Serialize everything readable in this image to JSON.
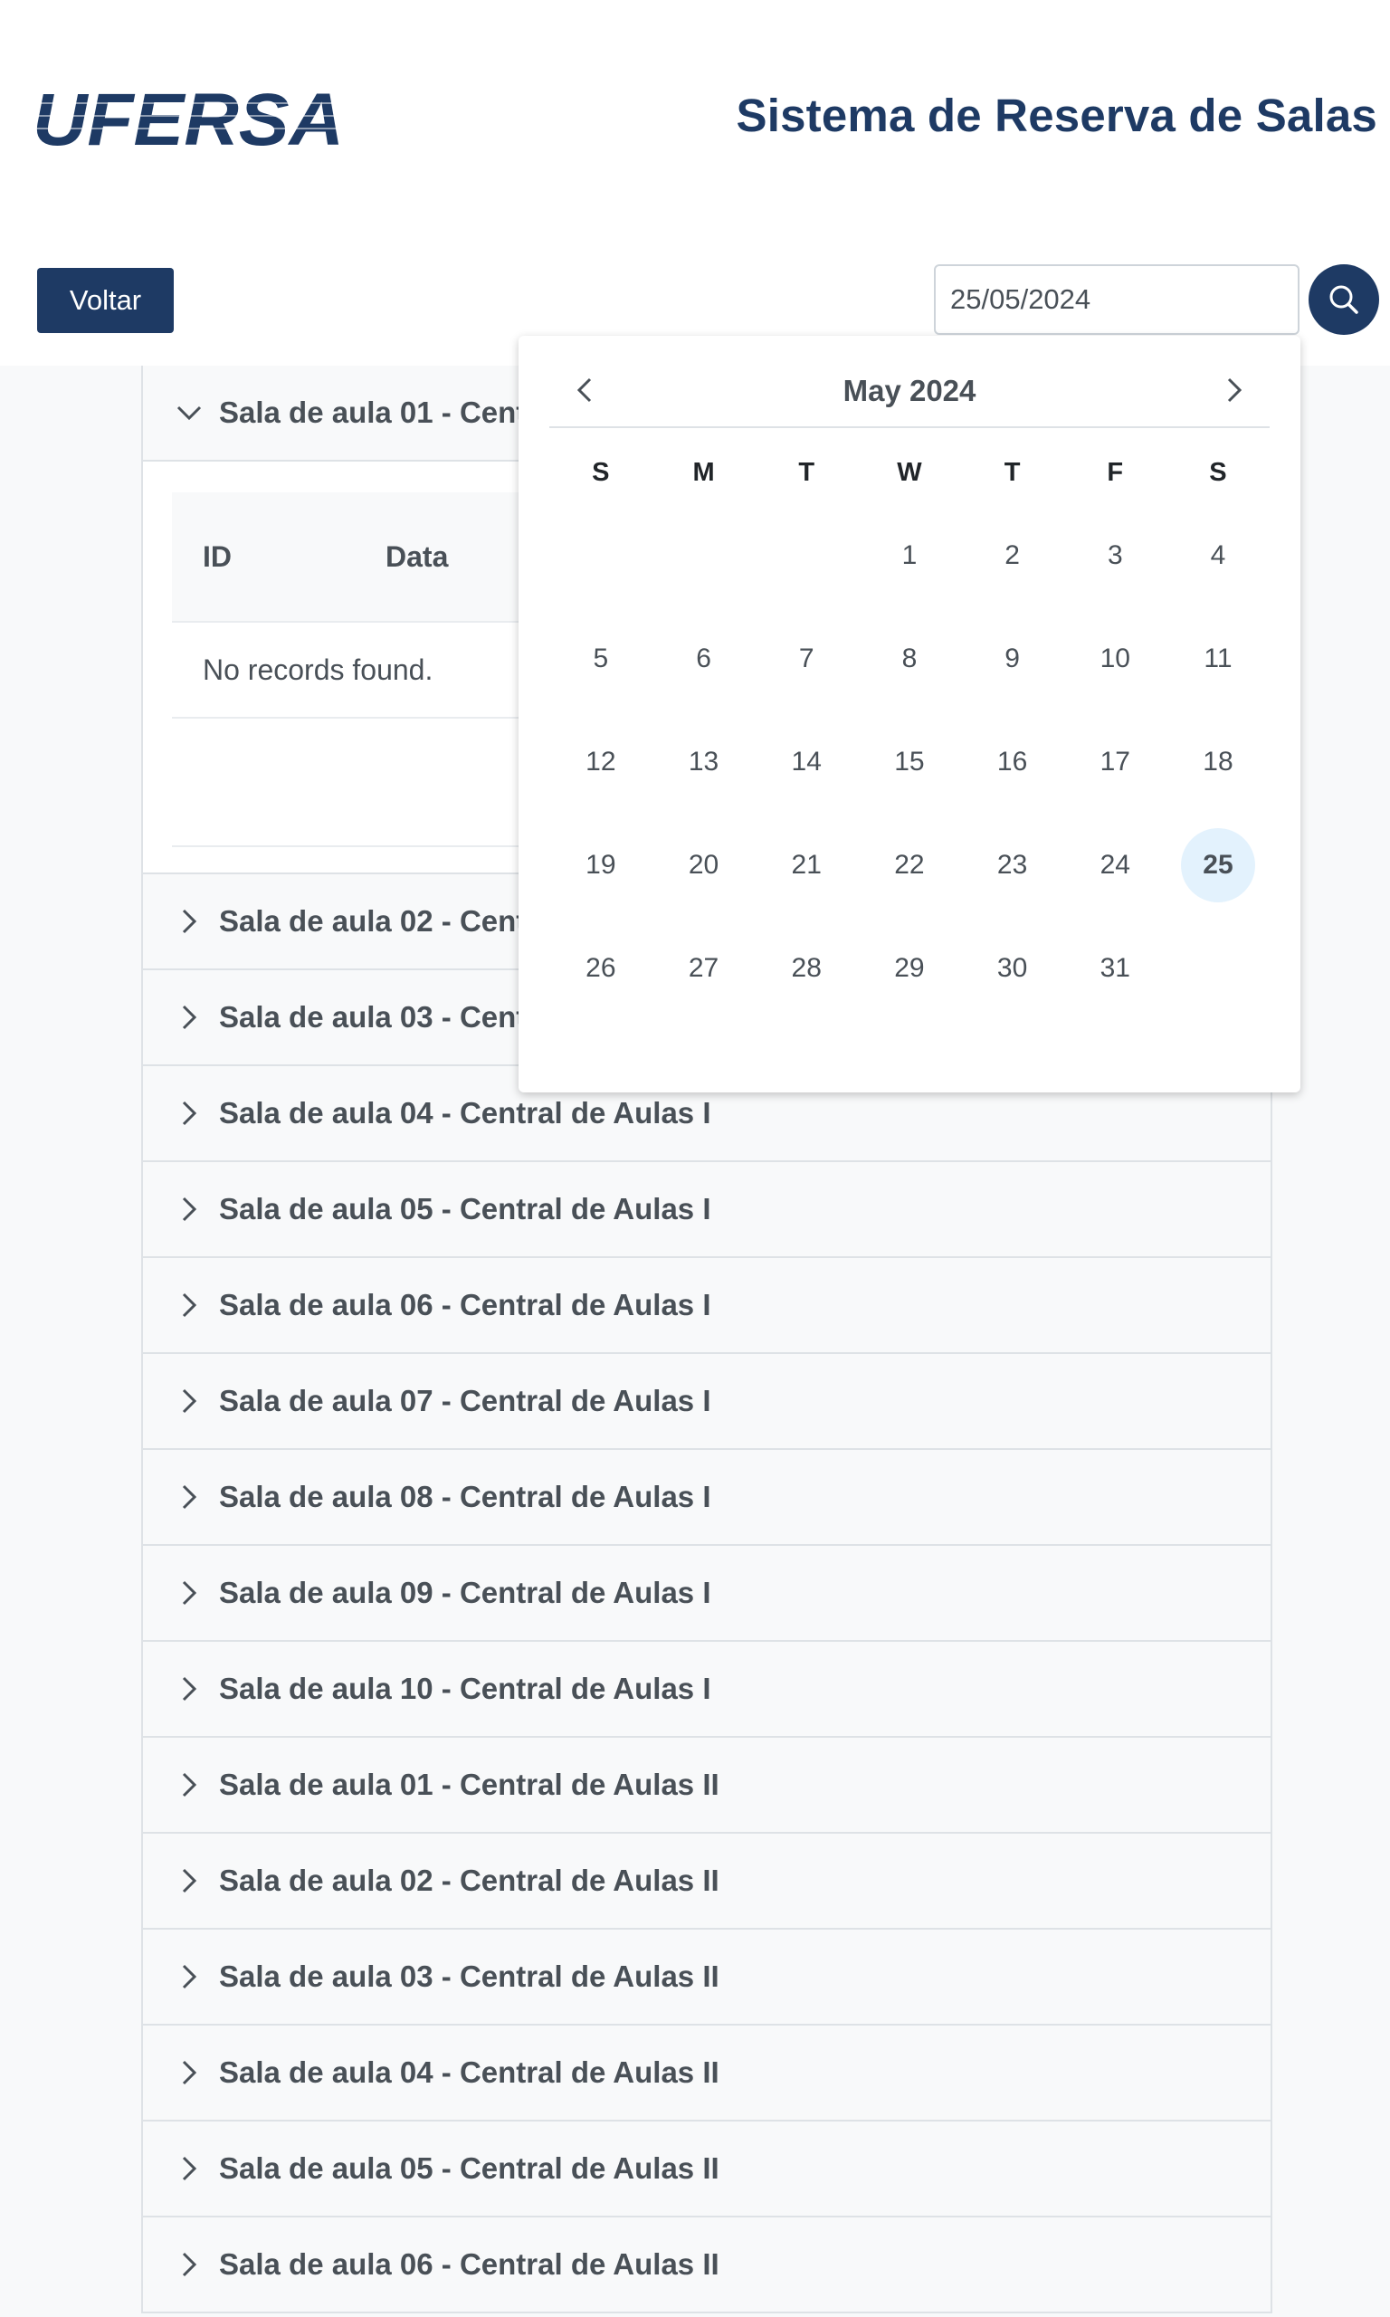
{
  "header": {
    "logo_text": "UFERSA",
    "title": "Sistema de Reserva de Salas"
  },
  "toolbar": {
    "back_label": "Voltar",
    "date_value": "25/05/2024",
    "search_icon": "search-icon"
  },
  "rooms": [
    {
      "label": "Sala de aula 01 - Central de Aulas I",
      "expanded": true
    },
    {
      "label": "Sala de aula 02 - Central de Aulas I"
    },
    {
      "label": "Sala de aula 03 - Central de Aulas I"
    },
    {
      "label": "Sala de aula 04 - Central de Aulas I"
    },
    {
      "label": "Sala de aula 05 - Central de Aulas I"
    },
    {
      "label": "Sala de aula 06 - Central de Aulas I"
    },
    {
      "label": "Sala de aula 07 - Central de Aulas I"
    },
    {
      "label": "Sala de aula 08 - Central de Aulas I"
    },
    {
      "label": "Sala de aula 09 - Central de Aulas I"
    },
    {
      "label": "Sala de aula 10 - Central de Aulas I"
    },
    {
      "label": "Sala de aula 01 - Central de Aulas II"
    },
    {
      "label": "Sala de aula 02 - Central de Aulas II"
    },
    {
      "label": "Sala de aula 03 - Central de Aulas II"
    },
    {
      "label": "Sala de aula 04 - Central de Aulas II"
    },
    {
      "label": "Sala de aula 05 - Central de Aulas II"
    },
    {
      "label": "Sala de aula 06 - Central de Aulas II"
    }
  ],
  "table": {
    "columns": [
      "ID",
      "Data"
    ],
    "empty_message": "No records found."
  },
  "calendar": {
    "month_label": "May 2024",
    "weekdays": [
      "S",
      "M",
      "T",
      "W",
      "T",
      "F",
      "S"
    ],
    "weeks": [
      [
        "",
        "",
        "",
        "1",
        "2",
        "3",
        "4"
      ],
      [
        "5",
        "6",
        "7",
        "8",
        "9",
        "10",
        "11"
      ],
      [
        "12",
        "13",
        "14",
        "15",
        "16",
        "17",
        "18"
      ],
      [
        "19",
        "20",
        "21",
        "22",
        "23",
        "24",
        "25"
      ],
      [
        "26",
        "27",
        "28",
        "29",
        "30",
        "31",
        ""
      ]
    ],
    "selected_day": "25"
  },
  "colors": {
    "brand": "#1e3a64",
    "selected_day_bg": "#e3f2fd",
    "page_bg": "#f8f9fa"
  }
}
